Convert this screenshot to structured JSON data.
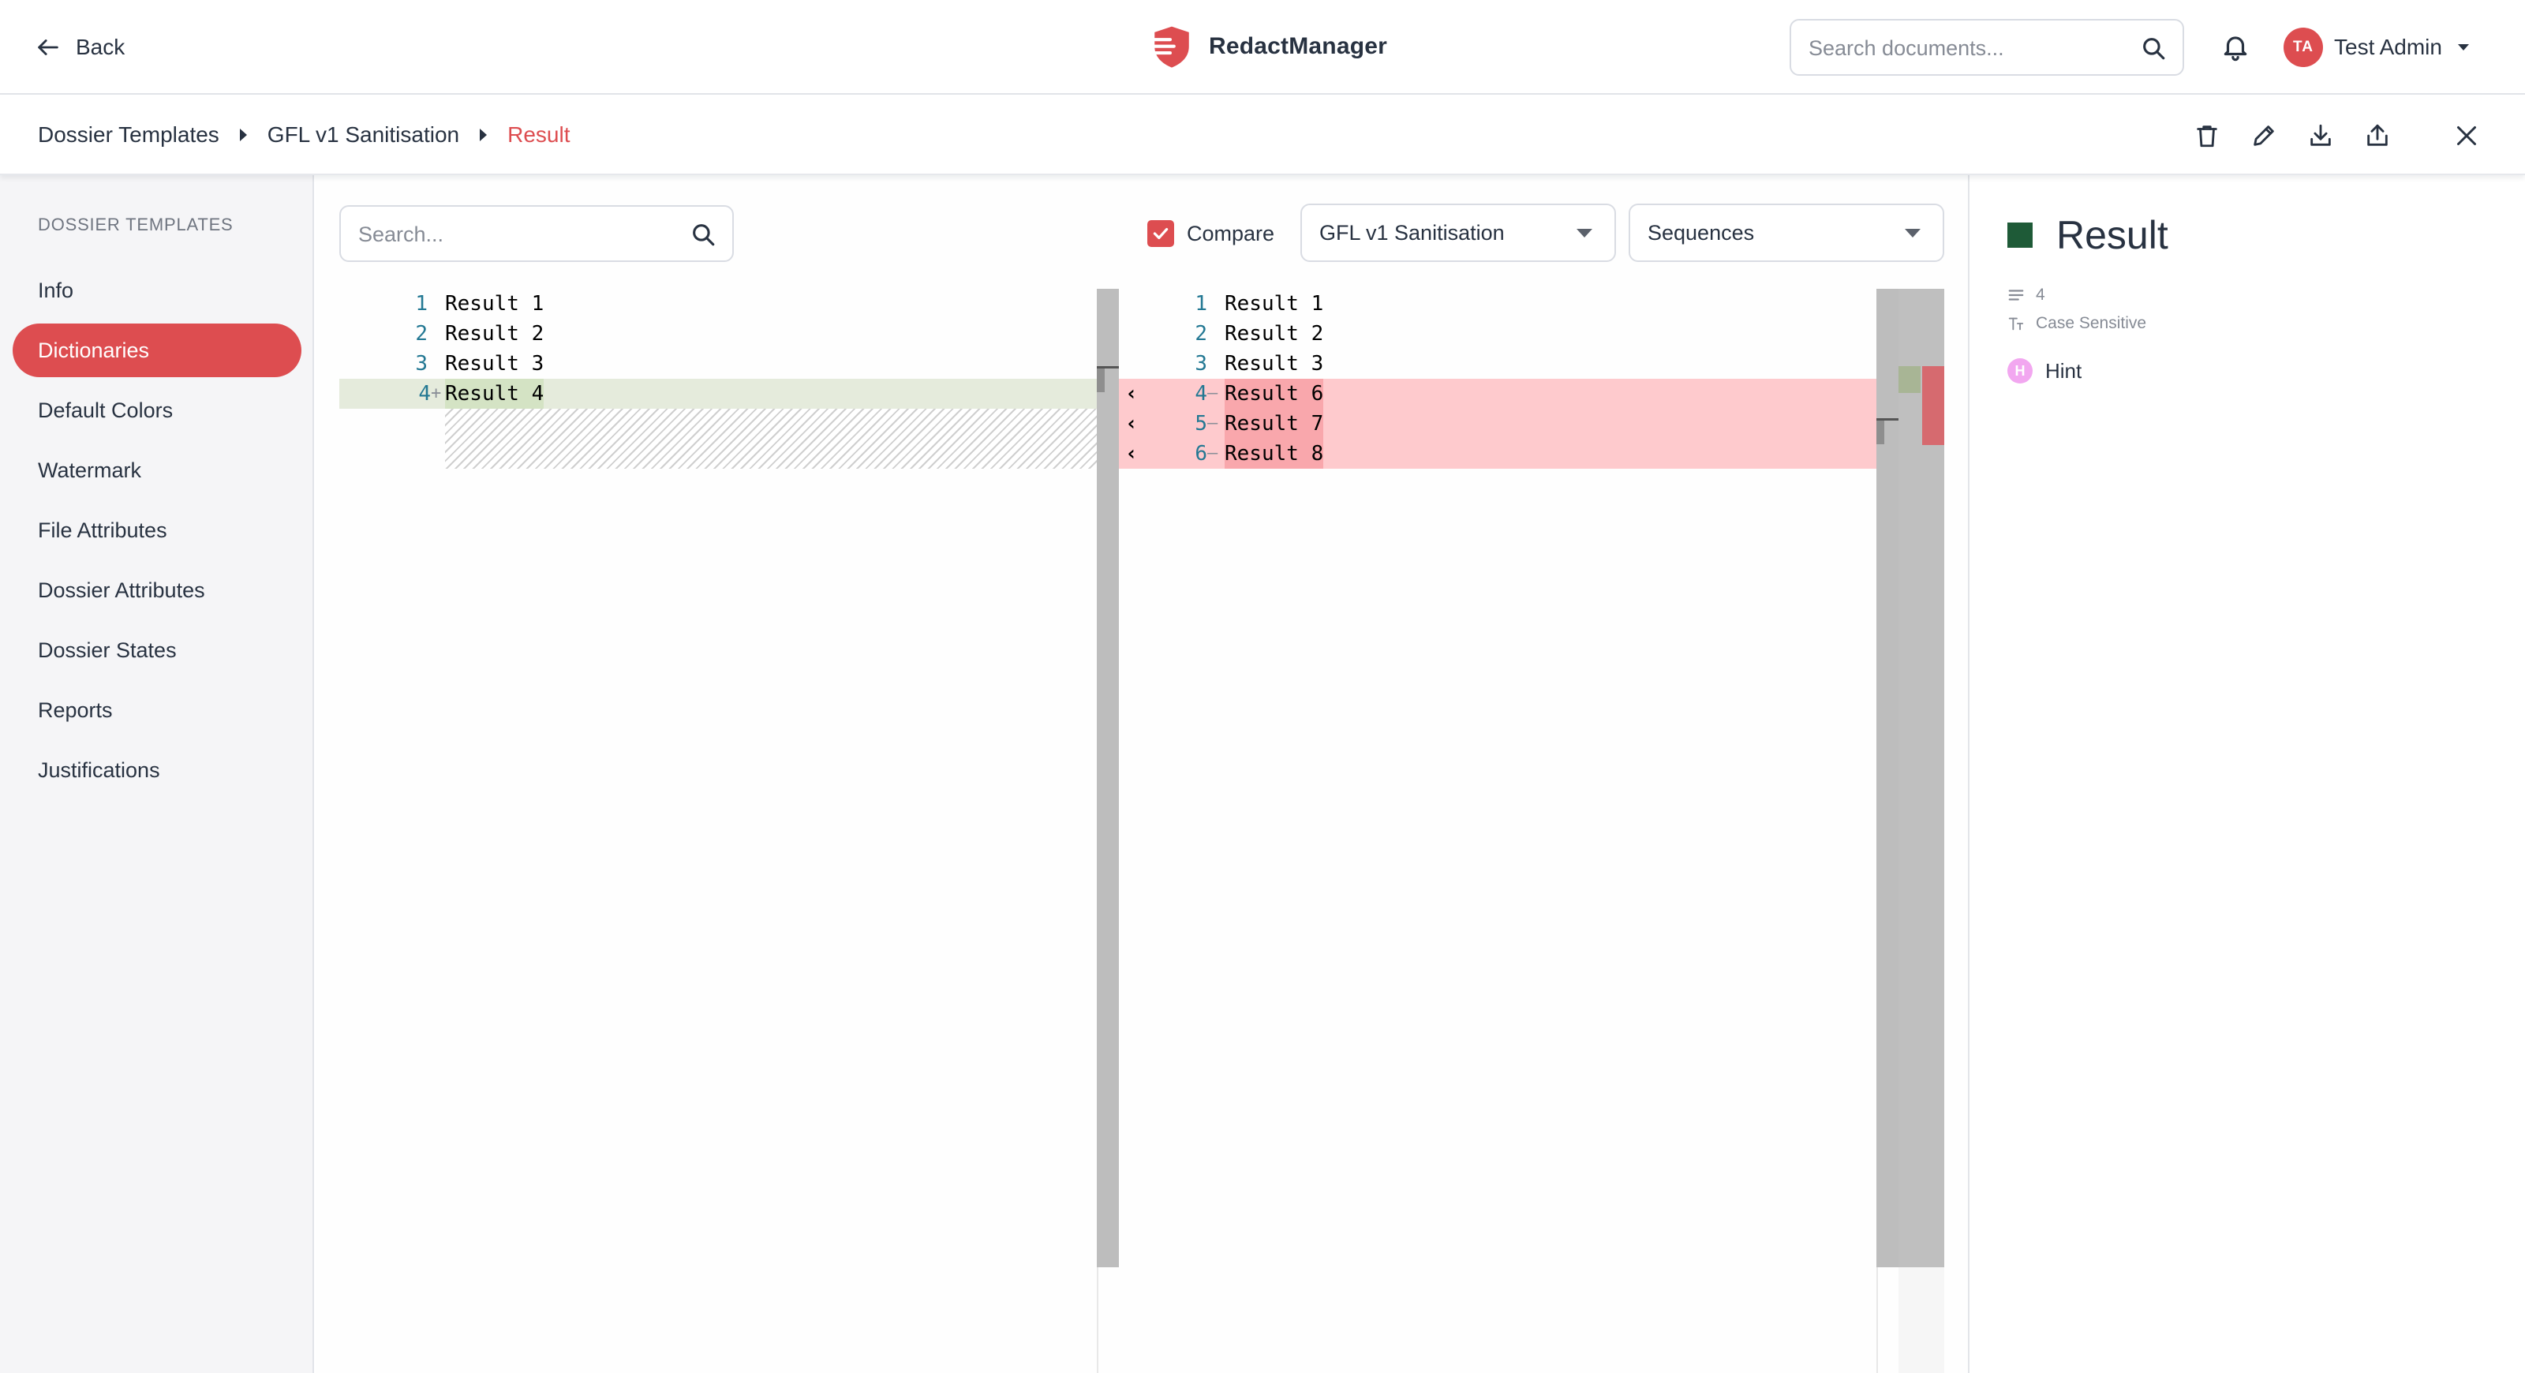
{
  "header": {
    "back_label": "Back",
    "brand_name": "RedactManager",
    "search_placeholder": "Search documents...",
    "user": {
      "initials": "TA",
      "name": "Test Admin"
    }
  },
  "breadcrumb": {
    "items": [
      "Dossier Templates",
      "GFL v1 Sanitisation",
      "Result"
    ]
  },
  "sidebar": {
    "title": "DOSSIER TEMPLATES",
    "items": [
      {
        "label": "Info"
      },
      {
        "label": "Dictionaries",
        "active": true
      },
      {
        "label": "Default Colors"
      },
      {
        "label": "Watermark"
      },
      {
        "label": "File Attributes"
      },
      {
        "label": "Dossier Attributes"
      },
      {
        "label": "Dossier States"
      },
      {
        "label": "Reports"
      },
      {
        "label": "Justifications"
      }
    ]
  },
  "toolbar": {
    "search_placeholder": "Search...",
    "compare_label": "Compare",
    "compare_checked": true,
    "template_select": "GFL v1 Sanitisation",
    "dictionary_select": "Sequences"
  },
  "diff": {
    "left": [
      {
        "num": "1",
        "marker": "",
        "text": "Result 1",
        "state": "same"
      },
      {
        "num": "2",
        "marker": "",
        "text": "Result 2",
        "state": "same"
      },
      {
        "num": "3",
        "marker": "",
        "text": "Result 3",
        "state": "same"
      },
      {
        "num": "4",
        "marker": "+",
        "text": "Result 4",
        "state": "added"
      }
    ],
    "right": [
      {
        "num": "1",
        "marker": "",
        "text": "Result 1",
        "state": "same"
      },
      {
        "num": "2",
        "marker": "",
        "text": "Result 2",
        "state": "same"
      },
      {
        "num": "3",
        "marker": "",
        "text": "Result 3",
        "state": "same"
      },
      {
        "num": "4",
        "marker": "—",
        "text": "Result 6",
        "state": "removed"
      },
      {
        "num": "5",
        "marker": "—",
        "text": "Result 7",
        "state": "removed"
      },
      {
        "num": "6",
        "marker": "—",
        "text": "Result 8",
        "state": "removed"
      }
    ],
    "revert_glyph": "‹"
  },
  "details": {
    "title": "Result",
    "color": "#1e5a37",
    "entry_count": "4",
    "case_label": "Case Sensitive",
    "type_initial": "H",
    "type_label": "Hint"
  },
  "colors": {
    "accent": "#dd4d50",
    "text": "#283241"
  }
}
